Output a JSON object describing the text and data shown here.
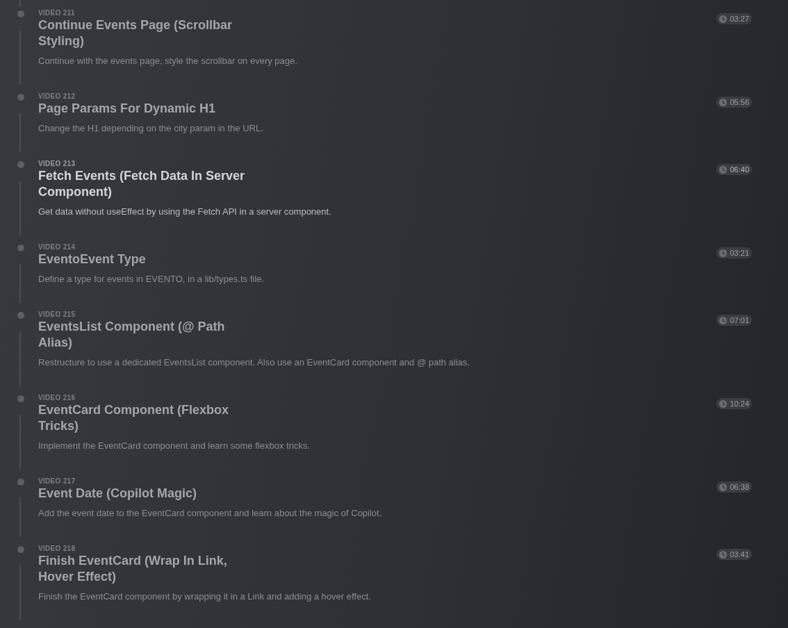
{
  "videos": [
    {
      "label": "VIDEO 211",
      "title": "Continue Events Page (Scrollbar Styling)",
      "description": "Continue with the events page, style the scrollbar on every page.",
      "duration": "03:27",
      "selected": false
    },
    {
      "label": "VIDEO 212",
      "title": "Page Params For Dynamic H1",
      "description": "Change the H1 depending on the city param in the URL.",
      "duration": "05:56",
      "selected": false
    },
    {
      "label": "VIDEO 213",
      "title": "Fetch Events (Fetch Data In Server Component)",
      "description": "Get data without useEffect by using the Fetch API in a server component.",
      "duration": "06:40",
      "selected": true
    },
    {
      "label": "VIDEO 214",
      "title": "EventoEvent Type",
      "description": "Define a type for events in EVENTO, in a lib/types.ts file.",
      "duration": "03:21",
      "selected": false
    },
    {
      "label": "VIDEO 215",
      "title": "EventsList Component (@ Path Alias)",
      "description": "Restructure to use a dedicated EventsList component. Also use an EventCard component and @ path alias.",
      "duration": "07:01",
      "selected": false
    },
    {
      "label": "VIDEO 216",
      "title": "EventCard Component (Flexbox Tricks)",
      "description": "Implement the EventCard component and learn some flexbox tricks.",
      "duration": "10:24",
      "selected": false
    },
    {
      "label": "VIDEO 217",
      "title": "Event Date (Copilot Magic)",
      "description": "Add the event date to the EventCard component and learn about the magic of Copilot.",
      "duration": "06:38",
      "selected": false
    },
    {
      "label": "VIDEO 218",
      "title": "Finish EventCard (Wrap In Link, Hover Effect)",
      "description": "Finish the EventCard component by wrapping it in a Link and adding a hover effect.",
      "duration": "03:41",
      "selected": false
    }
  ]
}
